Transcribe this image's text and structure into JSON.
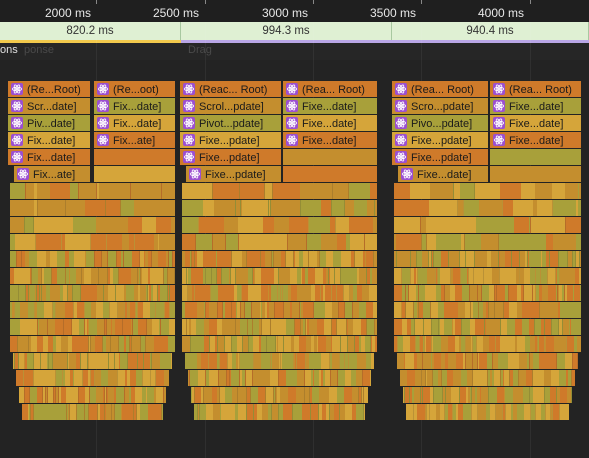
{
  "ruler": {
    "ticks": [
      "2000 ms",
      "2500 ms",
      "3000 ms",
      "3500 ms",
      "4000 ms"
    ]
  },
  "frames": {
    "durations": [
      "820.2 ms",
      "994.3 ms",
      "940.4 ms"
    ]
  },
  "interactions": {
    "left_label": "ons",
    "faded_label_1": "ponse",
    "faded_label_2": "Drag"
  },
  "flame": {
    "icon": "react-atom-icon",
    "colors": {
      "orange": "#cf7a2a",
      "amber": "#c48e2e",
      "olive": "#a8a03a",
      "gold": "#d5a53a",
      "icon_bg": "#9b4fd0"
    },
    "stacks": [
      {
        "columns": [
          [
            "(Re...Root)",
            "Scr...date]",
            "Piv...date]",
            "Fix...date]",
            "Fix...date]",
            "Fix...ate]"
          ],
          [
            "(Re...oot)",
            "Fix...date]",
            "Fix...date]",
            "Fix...ate]"
          ]
        ]
      },
      {
        "columns": [
          [
            "(Reac... Root)",
            "Scrol...pdate]",
            "Pivot...pdate]",
            "Fixe...pdate]",
            "Fixe...pdate]",
            "Fixe...pdate]"
          ],
          [
            "(Rea... Root)",
            "Fixe...date]",
            "Fixe...date]",
            "Fixe...date]"
          ]
        ]
      },
      {
        "columns": [
          [
            "(Rea... Root)",
            "Scro...pdate]",
            "Pivo...pdate]",
            "Fixe...pdate]",
            "Fixe...pdate]",
            "Fixe...date]"
          ],
          [
            "(Rea... Root)",
            "Fixe...date]",
            "Fixe...date]",
            "Fixe...date]"
          ]
        ]
      }
    ]
  }
}
